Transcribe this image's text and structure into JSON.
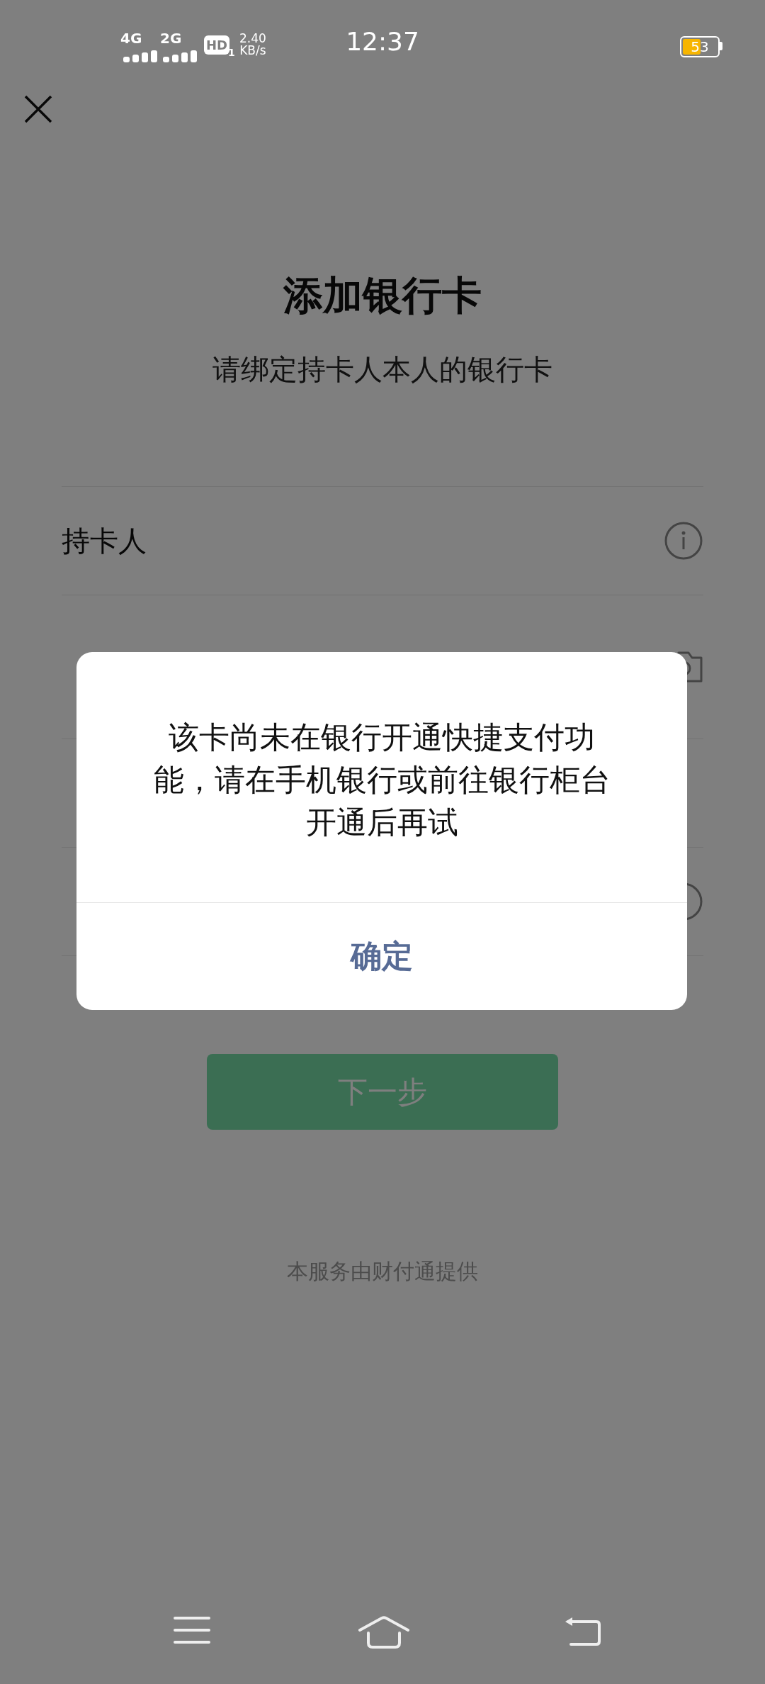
{
  "status_bar": {
    "network_1": "4G",
    "network_2": "2G",
    "hd": "HD",
    "hd_sim": "1",
    "speed_value": "2.40",
    "speed_unit": "KB/s",
    "time": "12:37",
    "battery": "53"
  },
  "page": {
    "title": "添加银行卡",
    "subtitle": "请绑定持卡人本人的银行卡",
    "rows": [
      {
        "kind": "info",
        "label": "持卡人"
      },
      {
        "kind": "camera"
      },
      {
        "kind": "plain"
      },
      {
        "kind": "info"
      }
    ],
    "next_button": "下一步",
    "footer": "本服务由财付通提供"
  },
  "dialog": {
    "message": "该卡尚未在银行开通快捷支付功能，请在手机银行或前往银行柜台开通后再试",
    "confirm": "确定"
  }
}
